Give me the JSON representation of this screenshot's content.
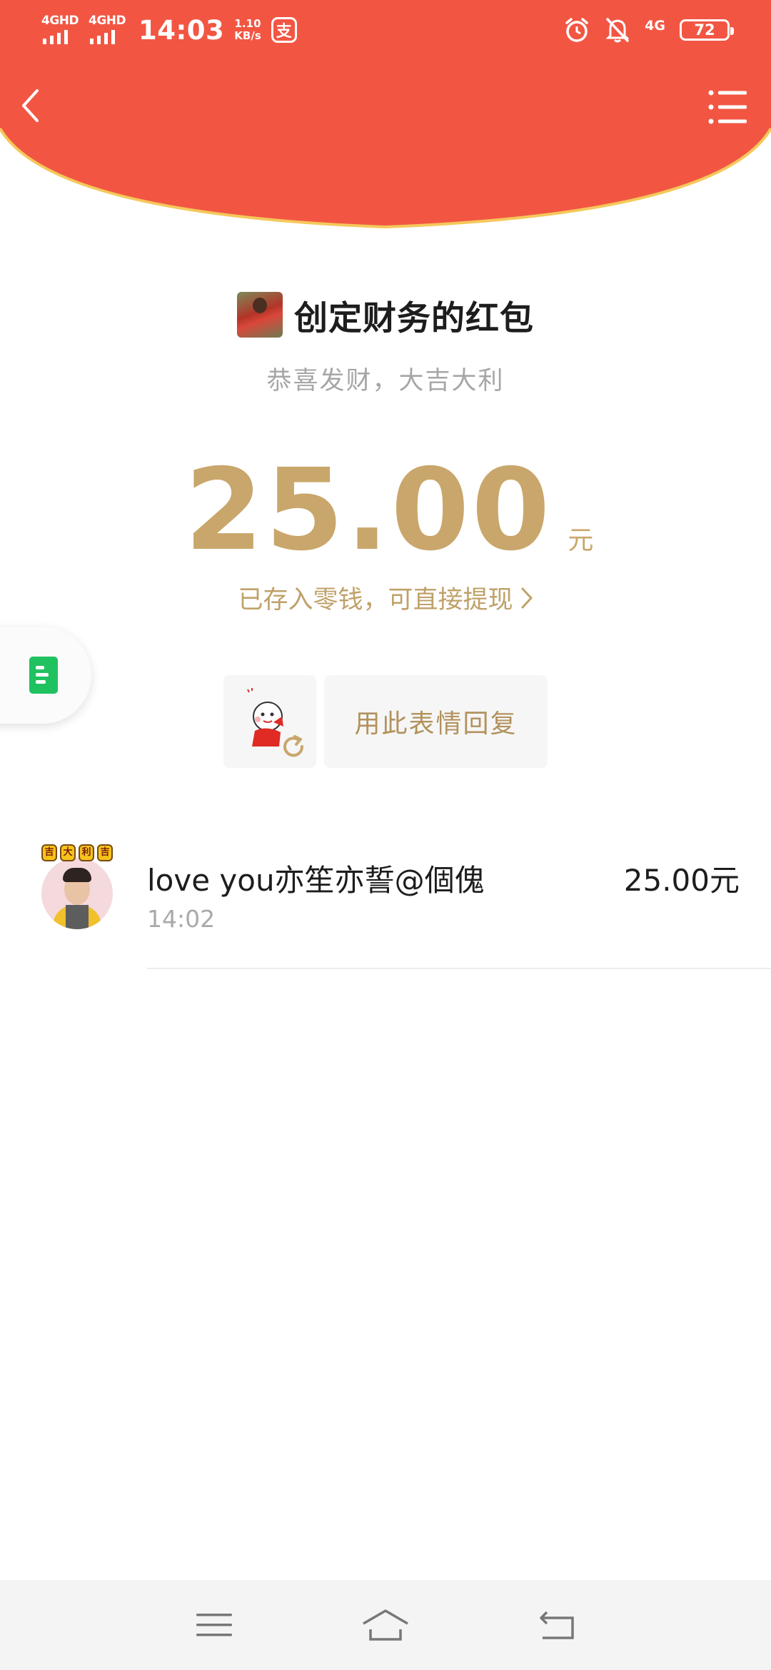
{
  "status_bar": {
    "sim1": "4GHD",
    "sim2": "4GHD",
    "time": "14:03",
    "speed_value": "1.10",
    "speed_unit": "KB/s",
    "alipay_glyph": "支",
    "network": "4G",
    "battery": "72",
    "icons": [
      "alarm-icon",
      "mute-icon"
    ]
  },
  "header": {
    "color": "#F25643",
    "accent_line": "#F5C85A"
  },
  "packet": {
    "title": "创定财务的红包",
    "greeting": "恭喜发财，大吉大利",
    "amount": "25.00",
    "unit": "元",
    "saved_text": "已存入零钱，可直接提现",
    "reply_label": "用此表情回复",
    "amount_color": "#C9A66B"
  },
  "claims": [
    {
      "name": "love you亦笙亦誓@個傀",
      "time": "14:02",
      "amount": "25.00元"
    }
  ]
}
